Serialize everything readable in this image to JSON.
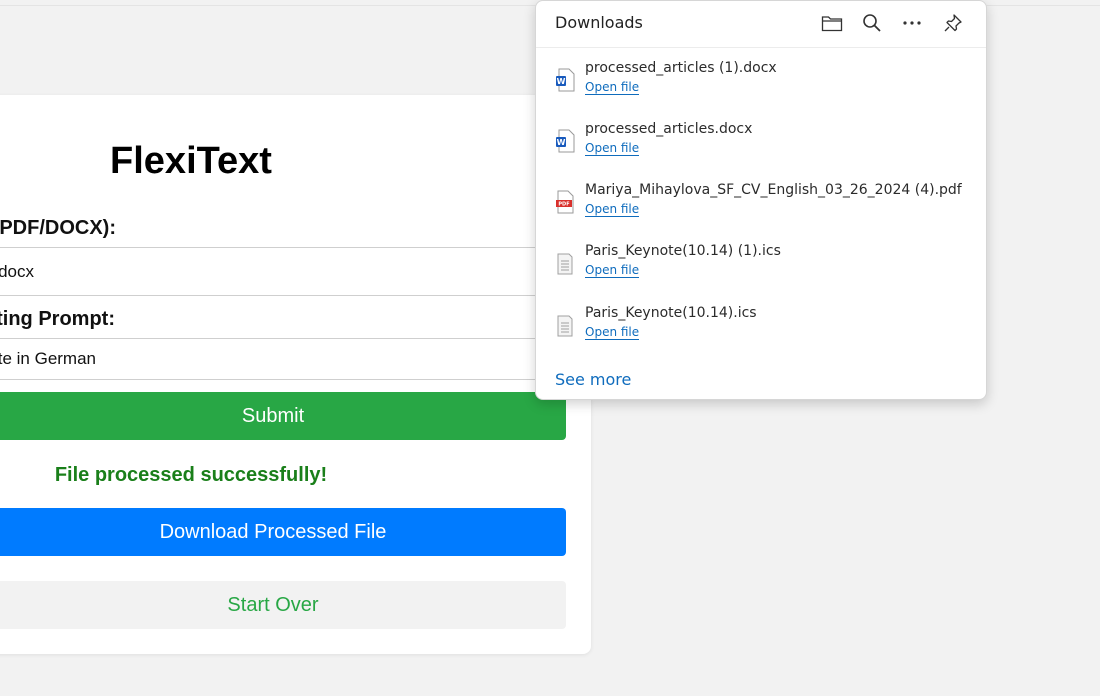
{
  "app": {
    "title": "FlexiText",
    "file_label": "PDF/DOCX):",
    "file_value": "docx",
    "prompt_label": "ting Prompt:",
    "prompt_value": "te in German",
    "submit_label": "Submit",
    "success_message": "File processed successfully!",
    "download_label": "Download Processed File",
    "start_over_label": "Start Over"
  },
  "downloads": {
    "title": "Downloads",
    "header_icons": [
      "folder-icon",
      "search-icon",
      "more-icon",
      "pin-icon"
    ],
    "items": [
      {
        "name": "processed_articles (1).docx",
        "action": "Open file",
        "icon": "word-doc-icon"
      },
      {
        "name": "processed_articles.docx",
        "action": "Open file",
        "icon": "word-doc-icon"
      },
      {
        "name": "Mariya_Mihaylova_SF_CV_English_03_26_2024 (4).pdf",
        "action": "Open file",
        "icon": "pdf-icon"
      },
      {
        "name": "Paris_Keynote(10.14) (1).ics",
        "action": "Open file",
        "icon": "generic-file-icon"
      },
      {
        "name": "Paris_Keynote(10.14).ics",
        "action": "Open file",
        "icon": "generic-file-icon"
      }
    ],
    "see_more": "See more"
  },
  "colors": {
    "submit": "#28a745",
    "download": "#007bff",
    "success_text": "#1a7f1a",
    "link": "#0f6cbd"
  }
}
